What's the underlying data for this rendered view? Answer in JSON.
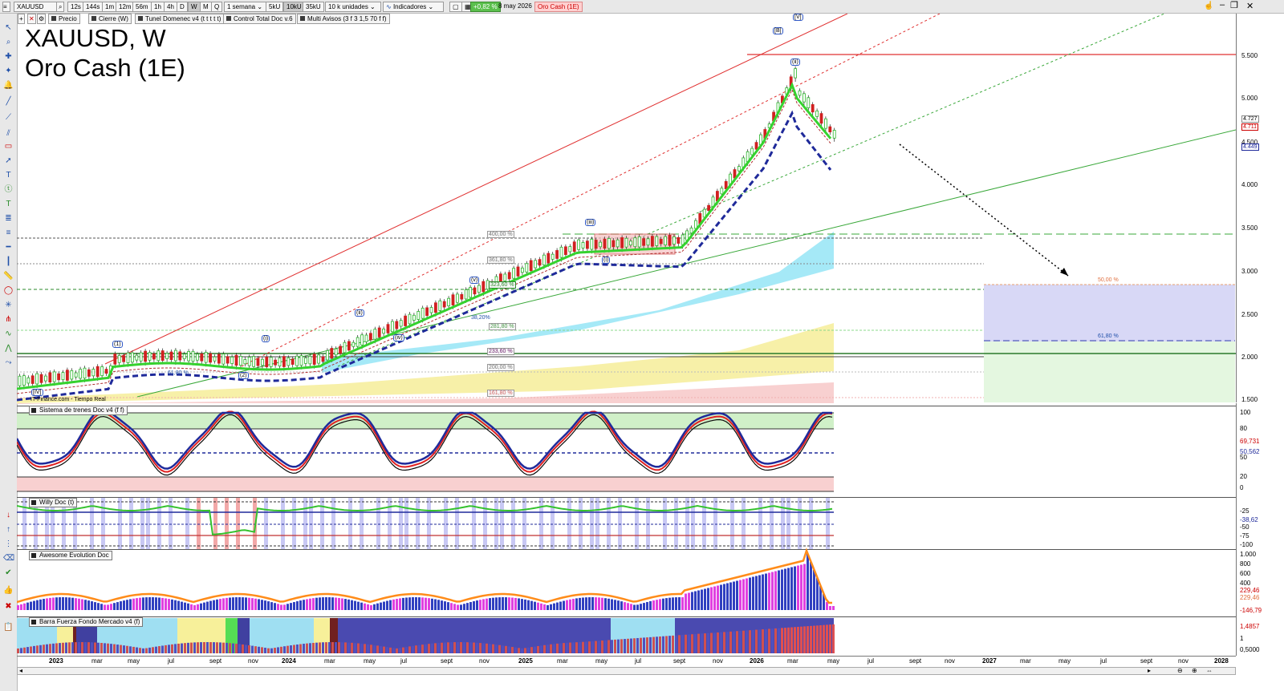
{
  "toolbar": {
    "symbol": "XAUUSD",
    "intervals": [
      "12s",
      "144s",
      "1m",
      "12m",
      "56m",
      "1h",
      "4h",
      "D",
      "W",
      "M",
      "Q"
    ],
    "active_interval": "W",
    "period": "1 semana",
    "tick_buttons": [
      "5kU",
      "10kU",
      "35kU"
    ],
    "units": "10 k unidades",
    "indicators_label": "Indicadores",
    "change": "+0,82 %",
    "date": "8 may 2026",
    "instrument_name": "Oro Cash (1E)"
  },
  "indicator_bar": {
    "items": [
      "Precio",
      "Cierre (W)",
      "Tunel Domenec v4 (t t t t t)",
      "Control Total Doc v.6",
      "Multi Avisos (3 f 3 1,5 70 f f)"
    ]
  },
  "chart_title": {
    "line1": "XAUUSD, W",
    "line2": "Oro Cash (1E)"
  },
  "source_label": "IT-Finance.com - Tiempo Real",
  "colors": {
    "bull_ema": "#35d22e",
    "dashed_blue": "#1f2a9a",
    "red_trend": "#e03030",
    "green_trend": "#3aa83a",
    "cloud_cyan": "#8fe3f5",
    "cloud_yellow": "#f7f0a8",
    "cloud_pink": "#f8d0d0",
    "target_blue": "#d8d8f6",
    "target_green": "#e4f7e0"
  },
  "price_axis": {
    "ticks": [
      "5.500",
      "5.000",
      "4.500",
      "4.000",
      "3.500",
      "3.000",
      "2.500",
      "2.000",
      "1.500"
    ],
    "badges": [
      "4.727",
      "4.711",
      "4.449"
    ]
  },
  "fib_labels": [
    "400,00 %",
    "361,80 %",
    "323,60 %",
    "281,80 %",
    "233,60 %",
    "200,00 %",
    "161,80 %",
    "61,80 %",
    "38,20%"
  ],
  "target_labels": [
    "50,00 %",
    "61,80 %"
  ],
  "wave_labels": [
    "(1)",
    "(i)",
    "(ii)",
    "(iii)",
    "(iv)",
    "(v)",
    "(iii)",
    "(ii)",
    "(i)",
    "[IV]",
    "[V]",
    "[B]",
    "(3)",
    "(4)",
    "(5)",
    "(1)",
    "(2)"
  ],
  "panels": [
    {
      "name": "Sistema de trenes Doc v4 (f f)",
      "axis": [
        "100",
        "80",
        "69,731",
        "50,562",
        "50",
        "20",
        "0"
      ]
    },
    {
      "name": "Willy Doc (t)",
      "axis": [
        "-25",
        "-38,62",
        "-50",
        "-75",
        "-100"
      ]
    },
    {
      "name": "Awesome Evolution Doc",
      "axis": [
        "1.000",
        "800",
        "600",
        "400",
        "229,46",
        "229,46",
        "-146,79"
      ]
    },
    {
      "name": "Barra Fuerza Fondo Mercado v4 (f)",
      "axis": [
        "1,4857",
        "1",
        "0,5000"
      ]
    }
  ],
  "time_axis": {
    "labels": [
      "2023",
      "mar",
      "may",
      "jul",
      "sept",
      "nov",
      "2024",
      "mar",
      "may",
      "jul",
      "sept",
      "nov",
      "2025",
      "mar",
      "may",
      "jul",
      "sept",
      "nov",
      "2026",
      "mar",
      "may",
      "jul",
      "sept",
      "nov",
      "2027",
      "mar",
      "may",
      "jul",
      "sept",
      "nov",
      "2028"
    ],
    "bold": [
      "2023",
      "2024",
      "2025",
      "2026",
      "2027",
      "2028"
    ]
  }
}
